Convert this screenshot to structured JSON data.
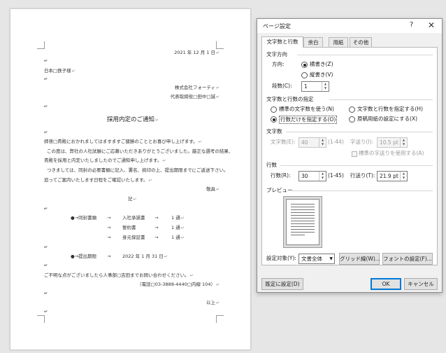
{
  "document": {
    "date": "2021 年 12 月 1 日",
    "addressee": "日本□鉄子様",
    "company": "株式会社フォーティ",
    "signer": "代表取締役□田中□誠",
    "title": "採用内定のご通知",
    "body_line1": "拝啓□貴殿におかれましてはますますご健勝のこととお喜び申し上げます。",
    "body_line2": "この度は、弊社の人社試験にご応募いただきありがとうございました。厳正な選考の結果、",
    "body_line3": "貴殿を採用と内定いたしましたのでご通知申し上げます。",
    "body_line4": "つきましては、同封の必要書類に記入、署名、捺印の上、提出期限までにご返送下さい。",
    "body_line5": "追ってご案内いたします日程をご確認いたします。",
    "closing1": "敬具",
    "ki": "記",
    "list_bullet": "●→同封書類",
    "item1_name": "入社承諾書",
    "item1_qty": "1 通",
    "item2_name": "誓約書",
    "item2_qty": "1 通",
    "item3_name": "身元保証書",
    "item3_qty": "1 通",
    "deadline_label": "●→提出期限",
    "deadline_value": "2022 年 1 月 31 日",
    "inquiry": "ご不明な点がございましたら人事部□吉田までお問い合わせください。",
    "phone": "（電話□03-3888-4440□内線 104）",
    "closing2": "以上",
    "arrow": "→",
    "return_mark": "↵"
  },
  "dialog": {
    "title": "ページ設定",
    "help": "?",
    "close": "✕",
    "tabs": [
      "文字数と行数",
      "余白",
      "用紙",
      "その他"
    ],
    "direction_group": "文字方向",
    "direction_label": "方向:",
    "horizontal": "横書き(Z)",
    "vertical": "縦書き(V)",
    "columns_label": "段数(C):",
    "columns_value": "1",
    "spec_group": "文字数と行数の指定",
    "opt_standard": "標準の文字数を使う(N)",
    "opt_chars_lines": "文字数と行数を指定する(H)",
    "opt_lines_only": "行数だけを指定する(O)",
    "opt_manuscript": "原稿用紙の設定にする(X)",
    "selected_option": "opt_lines_only",
    "chars_group": "文字数",
    "chars_label": "文字数(E):",
    "chars_value": "40",
    "chars_range": "(1-44)",
    "char_spacing_label": "字送り(I):",
    "char_spacing_value": "10.5 pt",
    "use_standard_spacing": "標準の字送りを使用する(A)",
    "lines_group": "行数",
    "lines_label": "行数(R):",
    "lines_value": "30",
    "lines_range": "(1-45)",
    "line_spacing_label": "行送り(T):",
    "line_spacing_value": "21.9 pt",
    "preview_group": "プレビュー",
    "apply_label": "設定対象(Y):",
    "apply_value": "文書全体",
    "grid_button": "グリッド線(W)...",
    "font_button": "フォントの設定(F)...",
    "default_button": "既定に設定(D)",
    "ok_button": "OK",
    "cancel_button": "キャンセル"
  }
}
